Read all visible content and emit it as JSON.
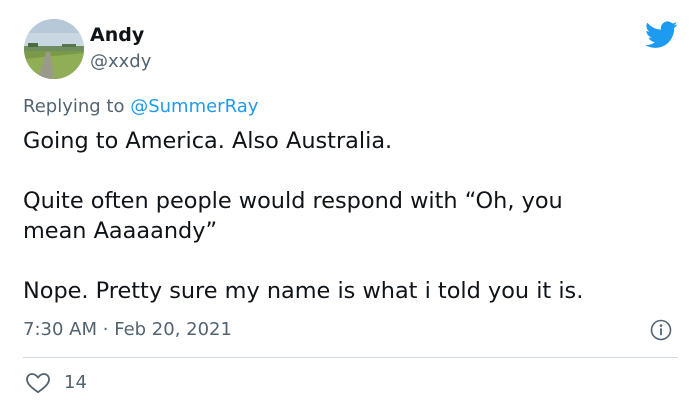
{
  "tweet": {
    "author": {
      "display_name": "Andy",
      "handle": "@xxdy"
    },
    "replying_to": {
      "prefix": "Replying to ",
      "mention": "@SummerRay"
    },
    "paragraphs": [
      "Going to America. Also Australia.",
      "Quite often people would respond with “Oh, you",
      "mean Aaaaandy”",
      "Nope. Pretty sure my name is what i told you it is."
    ],
    "time": "7:30 AM",
    "separator": "·",
    "date": "Feb 20, 2021",
    "likes": "14"
  },
  "icons": {
    "brand": "twitter-bird-icon",
    "info": "info-icon",
    "like": "heart-icon"
  },
  "colors": {
    "brand_blue": "#1d9bf0",
    "secondary_text": "#536471",
    "primary_text": "#0f1419",
    "divider": "#cfd9de"
  }
}
